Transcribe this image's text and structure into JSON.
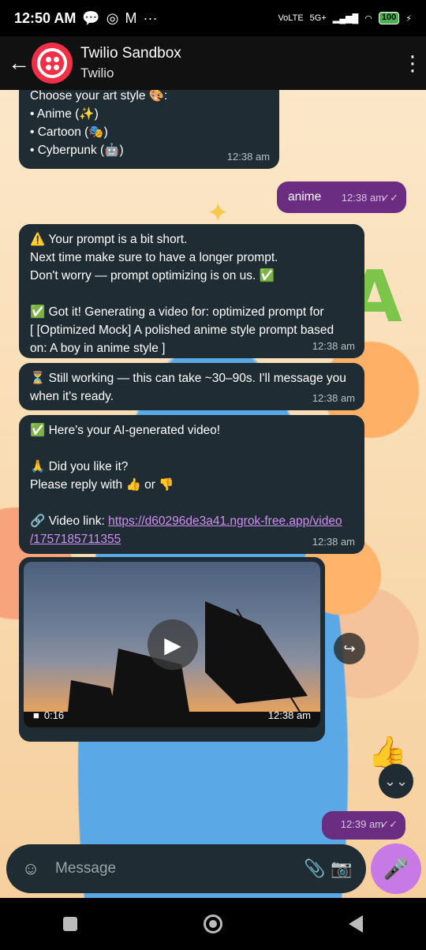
{
  "status_bar": {
    "time": "12:50 AM",
    "left_icons": [
      "chat-bubble-icon",
      "instagram-icon",
      "gmail-icon",
      "more-dots-icon"
    ],
    "network": "5G+",
    "battery": "100"
  },
  "header": {
    "title": "Twilio Sandbox",
    "subtitle": "Twilio"
  },
  "messages": [
    {
      "id": "style-options",
      "direction": "in",
      "lines": [
        "Choose your art style 🎨:",
        "• Anime (✨)",
        "• Cartoon (🎭)",
        "• Cyberpunk (🤖)"
      ],
      "time": "12:38 am"
    },
    {
      "id": "reply-anime",
      "direction": "out",
      "text": "anime",
      "time": "12:38 am",
      "ticks": "✓✓"
    },
    {
      "id": "prompt-short",
      "direction": "in",
      "lines": [
        "⚠️ Your prompt is a bit short.",
        "Next time make sure to have a longer prompt.",
        "Don't worry — prompt optimizing is on us. ✅",
        "",
        "✅ Got it! Generating a video for: optimized prompt for",
        "[ [Optimized Mock] A polished anime style prompt based",
        "on: A boy in anime style ]"
      ],
      "time": "12:38 am"
    },
    {
      "id": "still-working",
      "direction": "in",
      "lines": [
        "⏳ Still working — this can take ~30–90s. I'll message you",
        "when it's ready."
      ],
      "time": "12:38 am"
    },
    {
      "id": "video-ready",
      "direction": "in",
      "lines": [
        "✅ Here's your AI-generated video!",
        "",
        "🙏 Did you like it?",
        "Please reply with 👍 or 👎",
        ""
      ],
      "link_prefix": "🔗 Video link: ",
      "link_line1": "https://d60296de3a41.ngrok-free.app/video",
      "link_line2": "/1757185711355",
      "time": "12:38 am"
    }
  ],
  "video": {
    "duration": "0:16",
    "time": "12:38 am"
  },
  "last_out": {
    "time": "12:39 am",
    "ticks": "✓✓"
  },
  "input": {
    "placeholder": "Message"
  }
}
